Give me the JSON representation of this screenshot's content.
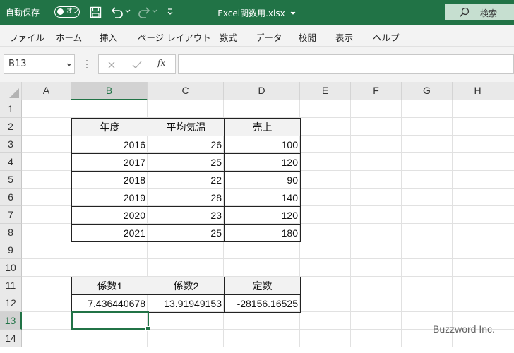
{
  "titlebar": {
    "autosave_label": "自動保存",
    "autosave_state": "オフ",
    "filename": "Excel関数用.xlsx",
    "search_label": "検索",
    "bg_color": "#217346"
  },
  "ribbon_tabs": [
    "ファイル",
    "ホーム",
    "挿入",
    "ページ レイアウト",
    "数式",
    "データ",
    "校閲",
    "表示",
    "ヘルプ"
  ],
  "formula_bar": {
    "name_box": "B13",
    "fx_label": "fx",
    "formula": ""
  },
  "columns": [
    "A",
    "B",
    "C",
    "D",
    "E",
    "F",
    "G",
    "H"
  ],
  "rows": [
    "1",
    "2",
    "3",
    "4",
    "5",
    "6",
    "7",
    "8",
    "9",
    "10",
    "11",
    "12",
    "13",
    "14"
  ],
  "selected_cell": "B13",
  "table1": {
    "headers": [
      "年度",
      "平均気温",
      "売上"
    ],
    "rows": [
      [
        "2016",
        "26",
        "100"
      ],
      [
        "2017",
        "25",
        "120"
      ],
      [
        "2018",
        "22",
        "90"
      ],
      [
        "2019",
        "28",
        "140"
      ],
      [
        "2020",
        "23",
        "120"
      ],
      [
        "2021",
        "25",
        "180"
      ]
    ]
  },
  "table2": {
    "headers": [
      "係数1",
      "係数2",
      "定数"
    ],
    "values": [
      "7.436440678",
      "13.91949153",
      "-28156.16525"
    ]
  },
  "watermark": "Buzzword Inc."
}
